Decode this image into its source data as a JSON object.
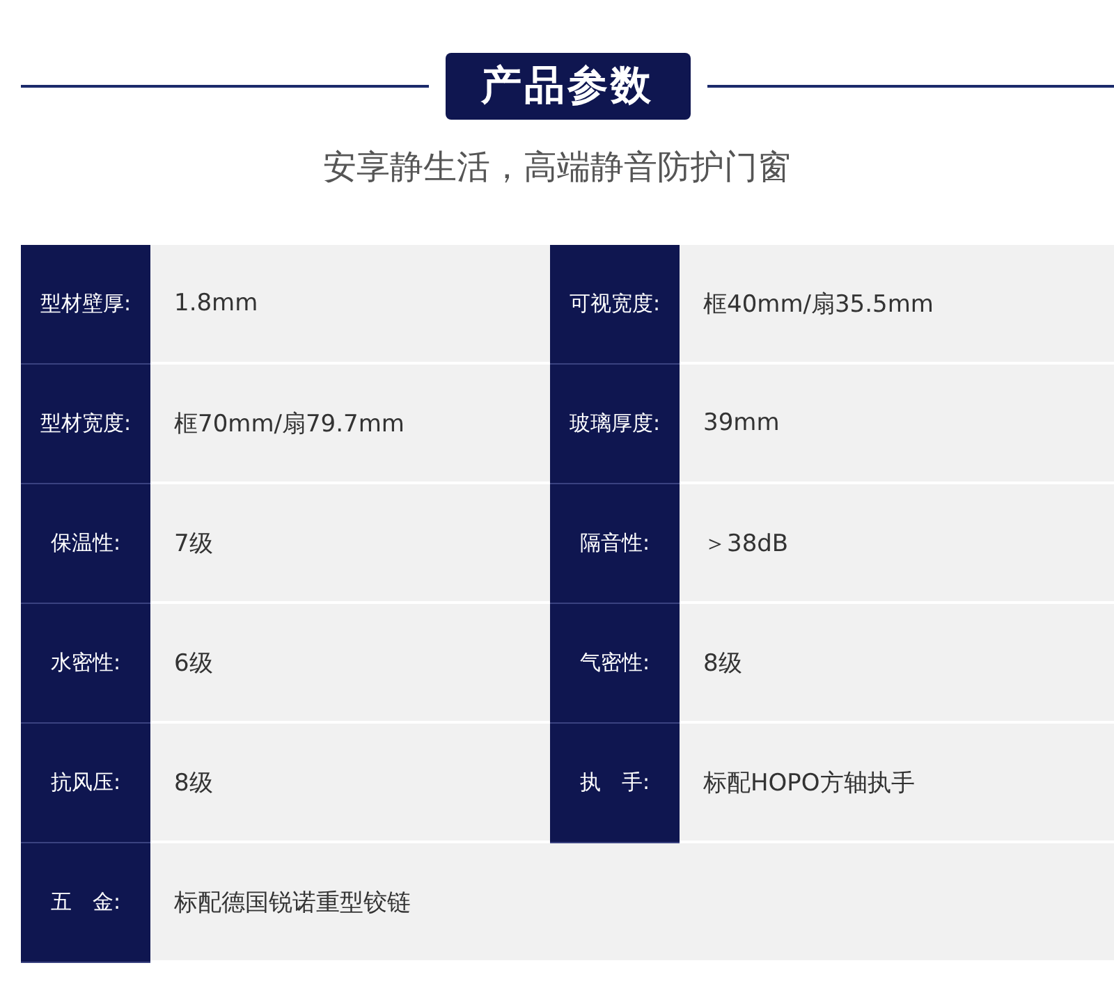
{
  "header": {
    "title": "产品参数",
    "subtitle": "安享静生活，高端静音防护门窗"
  },
  "spec_rows": [
    {
      "specs": [
        {
          "label": "型材壁厚:",
          "value": "1.8mm"
        },
        {
          "label": "可视宽度:",
          "value": "框40mm/扇35.5mm"
        }
      ]
    },
    {
      "specs": [
        {
          "label": "型材宽度:",
          "value": "框70mm/扇79.7mm"
        },
        {
          "label": "玻璃厚度:",
          "value": "39mm"
        }
      ]
    },
    {
      "specs": [
        {
          "label": "保温性:",
          "value": "7级"
        },
        {
          "label": "隔音性:",
          "value": "＞38dB"
        }
      ]
    },
    {
      "specs": [
        {
          "label": "水密性:",
          "value": "6级"
        },
        {
          "label": "气密性:",
          "value": "8级"
        }
      ]
    },
    {
      "specs": [
        {
          "label": "抗风压:",
          "value": "8级"
        },
        {
          "label": "执　手:",
          "value": "标配HOPO方轴执手"
        }
      ]
    },
    {
      "specs": [
        {
          "label": "五　金:",
          "value": "标配德国锐诺重型铰链"
        }
      ]
    }
  ]
}
